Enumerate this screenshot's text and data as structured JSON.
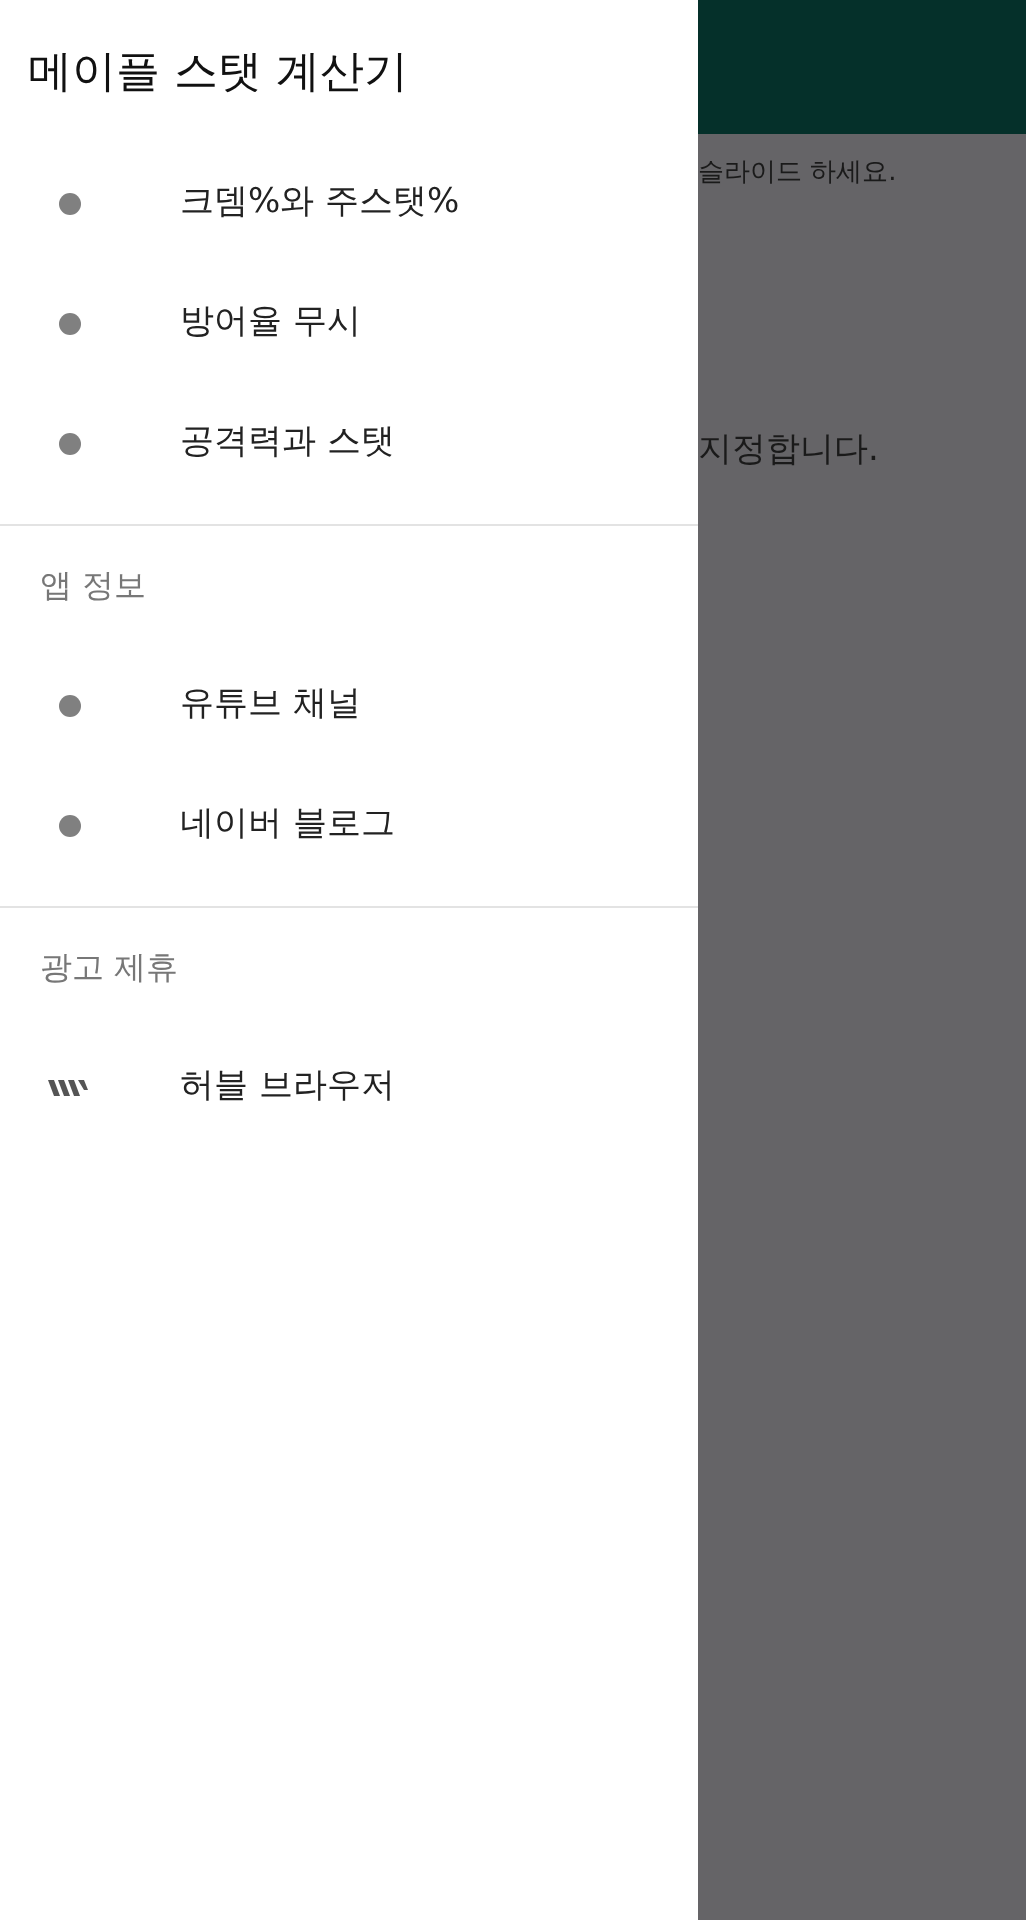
{
  "background_app": {
    "texts": [
      "슬라이드 하세요.",
      "지정합니다."
    ]
  },
  "drawer": {
    "title": "메이플 스탯 계산기",
    "sections": [
      {
        "items": [
          {
            "label": "크뎀%와 주스탯%",
            "kind": "dot"
          },
          {
            "label": "방어율 무시",
            "kind": "dot"
          },
          {
            "label": "공격력과 스탯",
            "kind": "dot"
          }
        ]
      },
      {
        "header": "앱 정보",
        "items": [
          {
            "label": "유튜브 채널",
            "kind": "dot"
          },
          {
            "label": "네이버 블로그",
            "kind": "dot"
          }
        ]
      },
      {
        "header": "광고 제휴",
        "items": [
          {
            "label": "허블 브라우저",
            "kind": "logo"
          }
        ]
      }
    ]
  }
}
